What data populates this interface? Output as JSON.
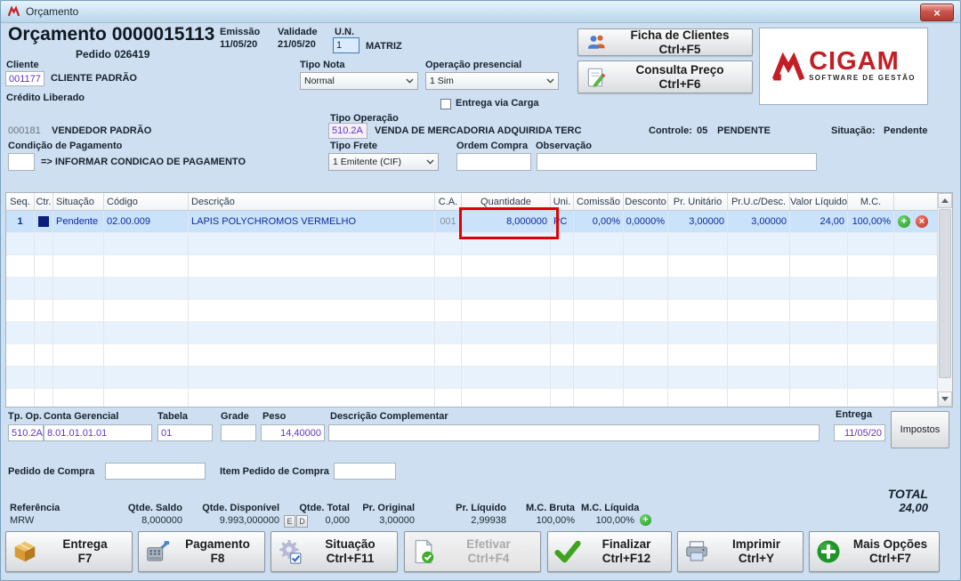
{
  "window": {
    "title": "Orçamento"
  },
  "header": {
    "doc_title": "Orçamento 0000015113",
    "pedido": "Pedido 026419",
    "emissao_label": "Emissão",
    "emissao_value": "11/05/20",
    "validade_label": "Validade",
    "validade_value": "21/05/20",
    "un_label": "U.N.",
    "un_value": "1",
    "un_name": "MATRIZ",
    "cliente_label": "Cliente",
    "cliente_code": "001177",
    "cliente_name": "CLIENTE PADRÃO",
    "credito_status": "Crédito Liberado",
    "tipo_nota_label": "Tipo Nota",
    "tipo_nota_value": "Normal",
    "operacao_presencial_label": "Operação presencial",
    "operacao_presencial_value": "1 Sim",
    "entrega_via_carga_label": "Entrega via Carga",
    "ficha_clientes_label": "Ficha de Clientes",
    "ficha_clientes_shortcut": "Ctrl+F5",
    "consulta_preco_label": "Consulta Preço",
    "consulta_preco_shortcut": "Ctrl+F6",
    "logo_text": "CIGAM",
    "logo_tagline": "SOFTWARE DE GESTÃO",
    "vendedor_code": "000181",
    "vendedor_name": "VENDEDOR PADRÃO",
    "tipo_operacao_label": "Tipo Operação",
    "tipo_operacao_code": "510.2A",
    "tipo_operacao_desc": "VENDA DE MERCADORIA ADQUIRIDA TERC",
    "controle_label": "Controle:",
    "controle_value": "05",
    "controle_status": "PENDENTE",
    "situacao_label": "Situação:",
    "situacao_value": "Pendente",
    "condicao_pagamento_label": "Condição de Pagamento",
    "condicao_pagamento_msg": "=> INFORMAR CONDICAO DE PAGAMENTO",
    "tipo_frete_label": "Tipo Frete",
    "tipo_frete_value": "1 Emitente (CIF)",
    "ordem_compra_label": "Ordem Compra",
    "observacao_label": "Observação"
  },
  "table": {
    "headers": [
      "Seq.",
      "Ctr.",
      "Situação",
      "Código",
      "Descrição",
      "C.A.",
      "Quantidade",
      "Uni.",
      "Comissão",
      "Desconto",
      "Pr. Unitário",
      "Pr.U.c/Desc.",
      "Valor Líquido",
      "M.C."
    ],
    "row1": {
      "seq": "1",
      "situacao": "Pendente",
      "codigo": "02.00.009",
      "descricao": "LAPIS POLYCHROMOS VERMELHO",
      "ca": "001",
      "quantidade": "8,000000",
      "uni": "PC",
      "comissao": "0,00%",
      "desconto": "0,0000%",
      "pr_unitario": "3,00000",
      "pr_u_c_desc": "3,00000",
      "valor_liquido": "24,00",
      "mc": "100,00%"
    }
  },
  "detail": {
    "tp_op_label": "Tp. Op.",
    "tp_op_value": "510.2A",
    "conta_gerencial_label": "Conta Gerencial",
    "conta_gerencial_value": "8.01.01.01.01",
    "tabela_label": "Tabela",
    "tabela_value": "01",
    "grade_label": "Grade",
    "peso_label": "Peso",
    "peso_value": "14,40000",
    "descricao_complementar_label": "Descrição Complementar",
    "entrega_label": "Entrega",
    "entrega_value": "11/05/20",
    "impostos_label": "Impostos",
    "pedido_compra_label": "Pedido de Compra",
    "item_pedido_compra_label": "Item Pedido de Compra"
  },
  "stats": {
    "referencia_label": "Referência",
    "referencia_value": "MRW",
    "qtde_saldo_label": "Qtde. Saldo",
    "qtde_saldo_value": "8,000000",
    "qtde_disponivel_label": "Qtde. Disponível",
    "qtde_disponivel_value": "9.993,000000",
    "btn_e": "E",
    "btn_d": "D",
    "qtde_total_label": "Qtde. Total",
    "qtde_total_value": "0,000",
    "pr_original_label": "Pr. Original",
    "pr_original_value": "3,00000",
    "pr_liquido_label": "Pr. Líquido",
    "pr_liquido_value": "2,99938",
    "mc_bruta_label": "M.C. Bruta",
    "mc_bruta_value": "100,00%",
    "mc_liquida_label": "M.C. Líquida",
    "mc_liquida_value": "100,00%",
    "total_label": "TOTAL",
    "total_value": "24,00"
  },
  "actions": {
    "entrega": {
      "label": "Entrega",
      "shortcut": "F7"
    },
    "pagamento": {
      "label": "Pagamento",
      "shortcut": "F8"
    },
    "situacao": {
      "label": "Situação",
      "shortcut": "Ctrl+F11"
    },
    "efetivar": {
      "label": "Efetivar",
      "shortcut": "Ctrl+F4"
    },
    "finalizar": {
      "label": "Finalizar",
      "shortcut": "Ctrl+F12"
    },
    "imprimir": {
      "label": "Imprimir",
      "shortcut": "Ctrl+Y"
    },
    "mais_opcoes": {
      "label": "Mais Opções",
      "shortcut": "Ctrl+F7"
    }
  },
  "colors": {
    "annotation_red": "#e10000",
    "selected_row_blue": "#cae3fa",
    "value_purple": "#5e35c4",
    "row_text_navy": "#0b2ba0",
    "logo_red": "#c41e25",
    "ok_green": "#259a25",
    "delete_red": "#c32e22"
  }
}
